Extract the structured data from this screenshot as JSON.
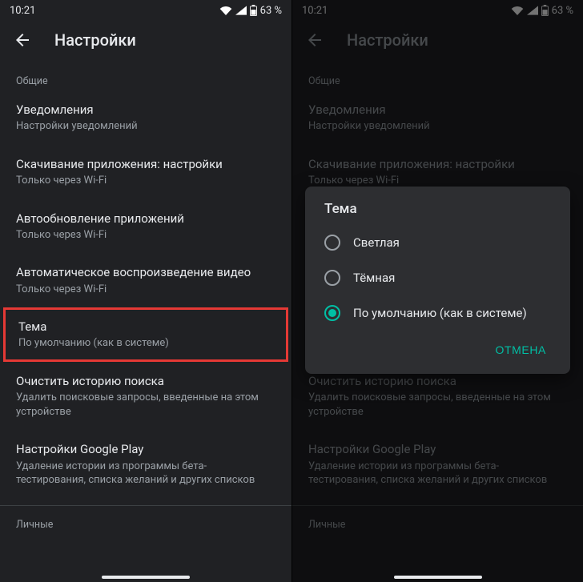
{
  "status": {
    "time": "10:21",
    "battery": "63 %"
  },
  "header": {
    "title": "Настройки"
  },
  "section_general": "Общие",
  "section_personal": "Личные",
  "items": {
    "notifications": {
      "title": "Уведомления",
      "sub": "Настройки уведомлений"
    },
    "download": {
      "title": "Скачивание приложения: настройки",
      "sub": "Только через Wi-Fi"
    },
    "autoupdate": {
      "title": "Автообновление приложений",
      "sub": "Только через Wi-Fi"
    },
    "autoplay": {
      "title": "Автоматическое воспроизведение видео",
      "sub": "Только через Wi-Fi"
    },
    "theme": {
      "title": "Тема",
      "sub": "По умолчанию (как в системе)"
    },
    "clear": {
      "title": "Очистить историю поиска",
      "sub": "Удалить поисковые запросы, введенные на этом устройстве"
    },
    "playsettings": {
      "title": "Настройки Google Play",
      "sub": "Удаление истории из программы бета-тестирования, списка желаний и других списков"
    }
  },
  "dialog": {
    "title": "Тема",
    "options": {
      "light": "Светлая",
      "dark": "Тёмная",
      "default": "По умолчанию (как в системе)"
    },
    "cancel": "ОТМЕНА"
  }
}
